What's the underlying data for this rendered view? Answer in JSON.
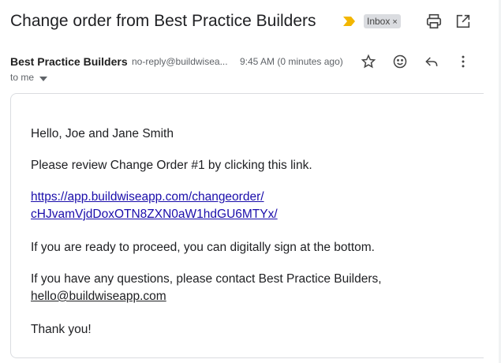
{
  "subject": "Change order from Best Practice Builders",
  "label": {
    "name": "Inbox",
    "remove_glyph": "×"
  },
  "sender": {
    "name": "Best Practice Builders",
    "email": "no-reply@buildwisea...",
    "time": "9:45 AM (0 minutes ago)"
  },
  "recipient": {
    "text": "to me"
  },
  "body": {
    "greeting": "Hello, Joe and Jane Smith",
    "instruction": "Please review Change Order #1 by clicking this link.",
    "link_line1": "https://app.buildwiseapp.com/changeorder/",
    "link_line2": "cHJvamVjdDoxOTN8ZXN0aW1hdGU6MTYx/",
    "proceed": "If you are ready to proceed, you can digitally sign at the bottom.",
    "questions": "If you have any questions, please contact Best Practice Builders,",
    "contact_email": "hello@buildwiseapp.com",
    "closing": "Thank you!"
  },
  "icons": {
    "importance": "importance-marker-icon",
    "print": "print-icon",
    "popout": "open-in-new-window-icon",
    "star": "star-icon",
    "emoji": "emoji-reaction-icon",
    "reply": "reply-icon",
    "more": "more-vert-icon",
    "recipient_toggle": "chevron-down-icon"
  },
  "colors": {
    "importance": "#f2b600",
    "link": "#1a0dab",
    "chip_bg": "#dadce0",
    "text": "#202124",
    "muted": "#5f6368"
  }
}
